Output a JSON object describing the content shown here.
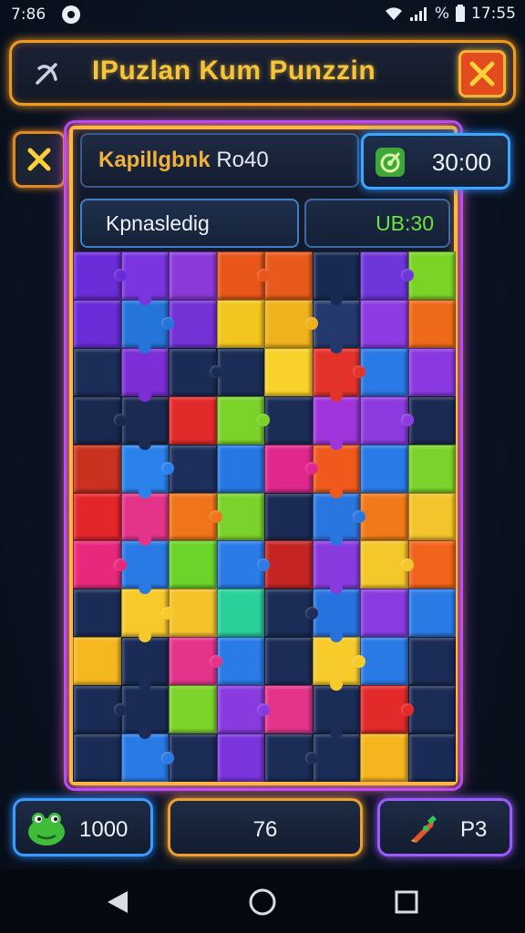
{
  "status_bar": {
    "time_left": "7:86",
    "battery_percent": "%",
    "time_right": "17:55"
  },
  "header": {
    "title": "IPuzlan Kum Punzzin"
  },
  "info": {
    "level_label": "Kapillgbnk",
    "level_value": "Ro40",
    "timer_value": "30:00",
    "mode_label": "Kpnasledig",
    "score_value": "UB:30"
  },
  "footer": {
    "coins_value": "1000",
    "moves_value": "76",
    "hints_value": "P3"
  },
  "colors": {
    "accent_orange": "#f29a1e",
    "accent_blue": "#39a7ff",
    "accent_purple": "#9b5bff",
    "score_green": "#6ee23a",
    "title_yellow": "#f6c33a"
  },
  "puzzle": {
    "columns": 8,
    "rows": 11,
    "pieces": [
      "#6a2cd6",
      "#7a35e0",
      "#8b3ad8",
      "#e8561a",
      "#e85a1c",
      "#172a52",
      "#6e35d9",
      "#7bd326",
      "#6a2cd6",
      "#2574d9",
      "#7332d6",
      "#f2c61f",
      "#f0b21c",
      "#243a6e",
      "#8d3be2",
      "#ee6a1a",
      "#1c2d58",
      "#7d2ed6",
      "#1a2b55",
      "#1b2c56",
      "#f8d12a",
      "#e3322a",
      "#2979e6",
      "#8a39e0",
      "#18284f",
      "#1a2a52",
      "#e32a2a",
      "#7bd32a",
      "#1b2c56",
      "#a035dc",
      "#8c3be0",
      "#1a2a52",
      "#c8321e",
      "#2a82ea",
      "#1d2f5c",
      "#2677e3",
      "#e0288c",
      "#ef5a1c",
      "#2a7ae8",
      "#7ad22a",
      "#e3262a",
      "#e3348a",
      "#f0741a",
      "#7ad22a",
      "#1a2b55",
      "#2a76e0",
      "#f07a1a",
      "#f3c42b",
      "#e8287a",
      "#2a7ae6",
      "#6ad42a",
      "#2a7ae8",
      "#c42424",
      "#8a3be0",
      "#f4c82a",
      "#f2631c",
      "#1a2b55",
      "#f7c92a",
      "#f5c22a",
      "#2ad09a",
      "#1b2c56",
      "#2872df",
      "#8a3be2",
      "#2a7ae6",
      "#f5b81f",
      "#1a2b55",
      "#e3348a",
      "#2a7ae8",
      "#1b2c56",
      "#f7cb2a",
      "#2a7ae6",
      "#1b2c56",
      "#1a2b55",
      "#1a2b55",
      "#7cd42a",
      "#8a3be0",
      "#e3348a",
      "#1b2c56",
      "#e32a2a",
      "#1b2c56",
      "#1a2b55",
      "#2a7ae6",
      "#1b2c56",
      "#7b34dc",
      "#1b2c56",
      "#1b2c56",
      "#f5b51f",
      "#1a2b55"
    ]
  }
}
